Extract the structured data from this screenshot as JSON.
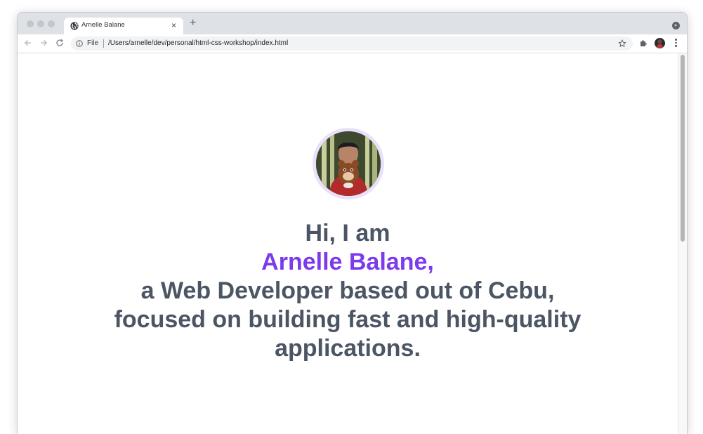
{
  "browser": {
    "tab": {
      "title": "Arnelle Balane",
      "favicon": "globe-icon",
      "close_label": "×"
    },
    "new_tab_label": "+",
    "omnibox": {
      "scheme_label": "File",
      "url": "/Users/arnelle/dev/personal/html-css-workshop/index.html"
    }
  },
  "page": {
    "greeting": "Hi, I am",
    "name": "Arnelle Balane,",
    "tagline_1": "a Web Developer based out of Cebu,",
    "tagline_2": "focused on building fast and high-quality",
    "tagline_3": "applications.",
    "accent_color": "#7c3aed",
    "text_color": "#4b5563",
    "photo_ring_color": "#e9e1fb"
  }
}
